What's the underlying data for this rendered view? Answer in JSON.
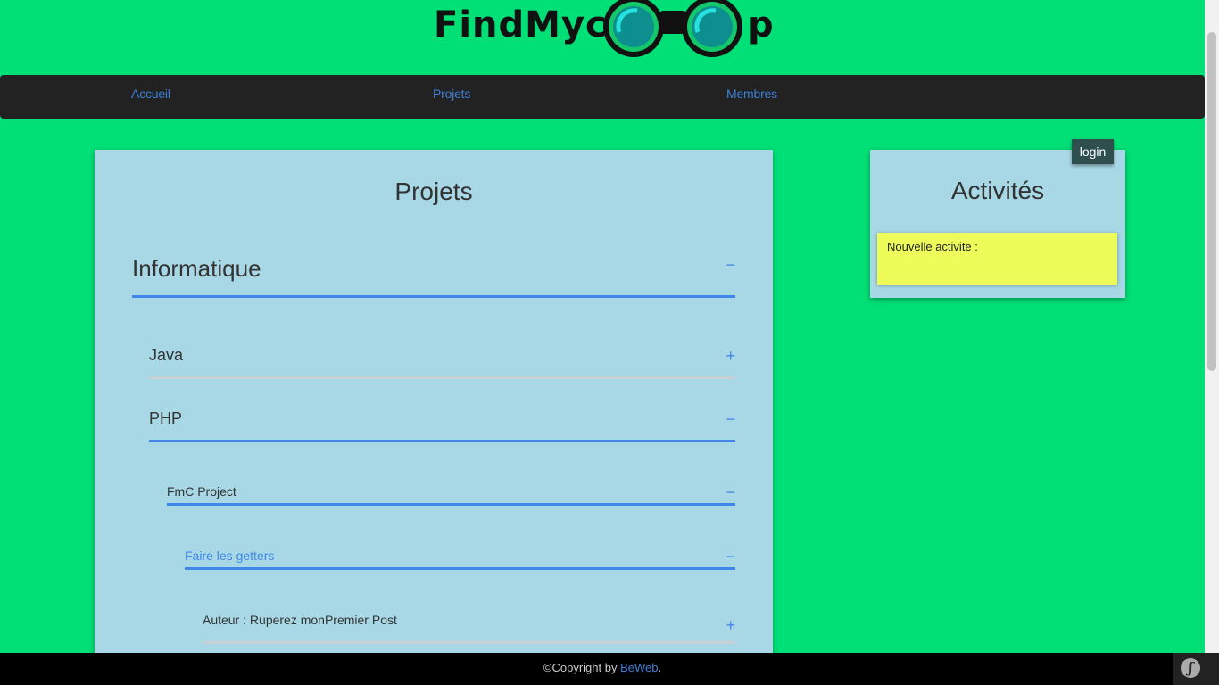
{
  "header": {
    "logo_part1": "FindMyc",
    "logo_part2": "p"
  },
  "nav": {
    "items": [
      {
        "label": "Accueil"
      },
      {
        "label": "Projets"
      },
      {
        "label": "Membres"
      }
    ]
  },
  "projects": {
    "title": "Projets",
    "tree": [
      {
        "label": "Informatique",
        "toggle": "−"
      },
      {
        "label": "Java",
        "toggle": "+"
      },
      {
        "label": "PHP",
        "toggle": "−"
      },
      {
        "label": "FmC Project",
        "toggle": "−"
      },
      {
        "label": "Faire les getters",
        "toggle": "−"
      },
      {
        "label": "Auteur : Ruperez monPremier Post",
        "toggle": "+"
      }
    ]
  },
  "activities": {
    "title": "Activités",
    "login_label": "login",
    "new_activity_label": "Nouvelle activite :"
  },
  "footer": {
    "copyright_prefix": "©Copyright by ",
    "brand_link": "BeWeb",
    "suffix": ".",
    "symfony_glyph": "ʃ"
  },
  "colors": {
    "page_background": "#00e077",
    "navbar": "#222222",
    "link": "#3f7fd6",
    "panel": "#a8d8e6",
    "accent_blue": "#3f86e8",
    "note_yellow": "#eefc5a",
    "login_button": "#2f4f4f"
  }
}
